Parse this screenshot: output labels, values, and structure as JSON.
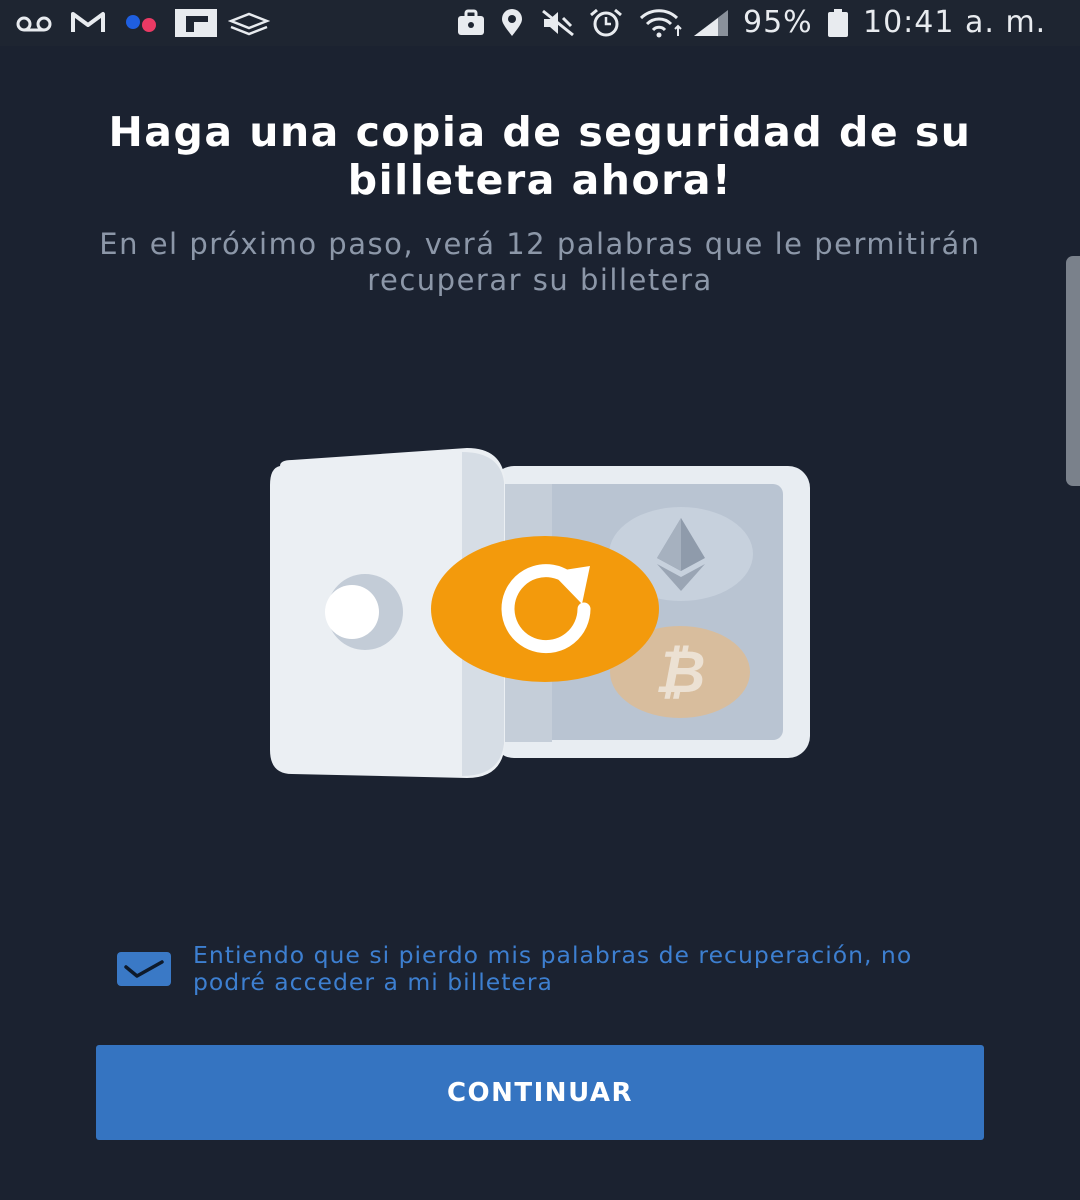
{
  "status_bar": {
    "left_icons": [
      "voicemail-icon",
      "gmail-icon",
      "flickr-icon",
      "flipboard-icon",
      "layers-icon"
    ],
    "right_icons": [
      "briefcase-icon",
      "location-icon",
      "mute-icon",
      "alarm-icon",
      "wifi-icon",
      "signal-icon",
      "battery-icon"
    ],
    "battery": "95%",
    "time": "10:41 a. m."
  },
  "header": {
    "title": "Haga una copia de seguridad de su billetera ahora!",
    "subtitle": "En el próximo paso, verá 12 palabras que le permitirán recuperar su billetera"
  },
  "illustration": {
    "icons": [
      "vault-icon",
      "ethereum-icon",
      "bitcoin-icon",
      "refresh-icon"
    ],
    "colors": {
      "vault": "#e8edf2",
      "vault_inside": "#b9c4d2",
      "refresh_badge": "#f39a0c",
      "bitcoin_coin": "#d8bd9d",
      "ethereum_coin": "#c7d1dd"
    }
  },
  "consent": {
    "checked": true,
    "label": "Entiendo que si pierdo mis palabras de recuperación, no podré acceder a mi billetera"
  },
  "actions": {
    "continue_label": "CONTINUAR"
  },
  "colors": {
    "background": "#1b2230",
    "accent": "#3574c1",
    "consent_text": "#3d7fd0",
    "subtitle_text": "#8c97a8"
  }
}
